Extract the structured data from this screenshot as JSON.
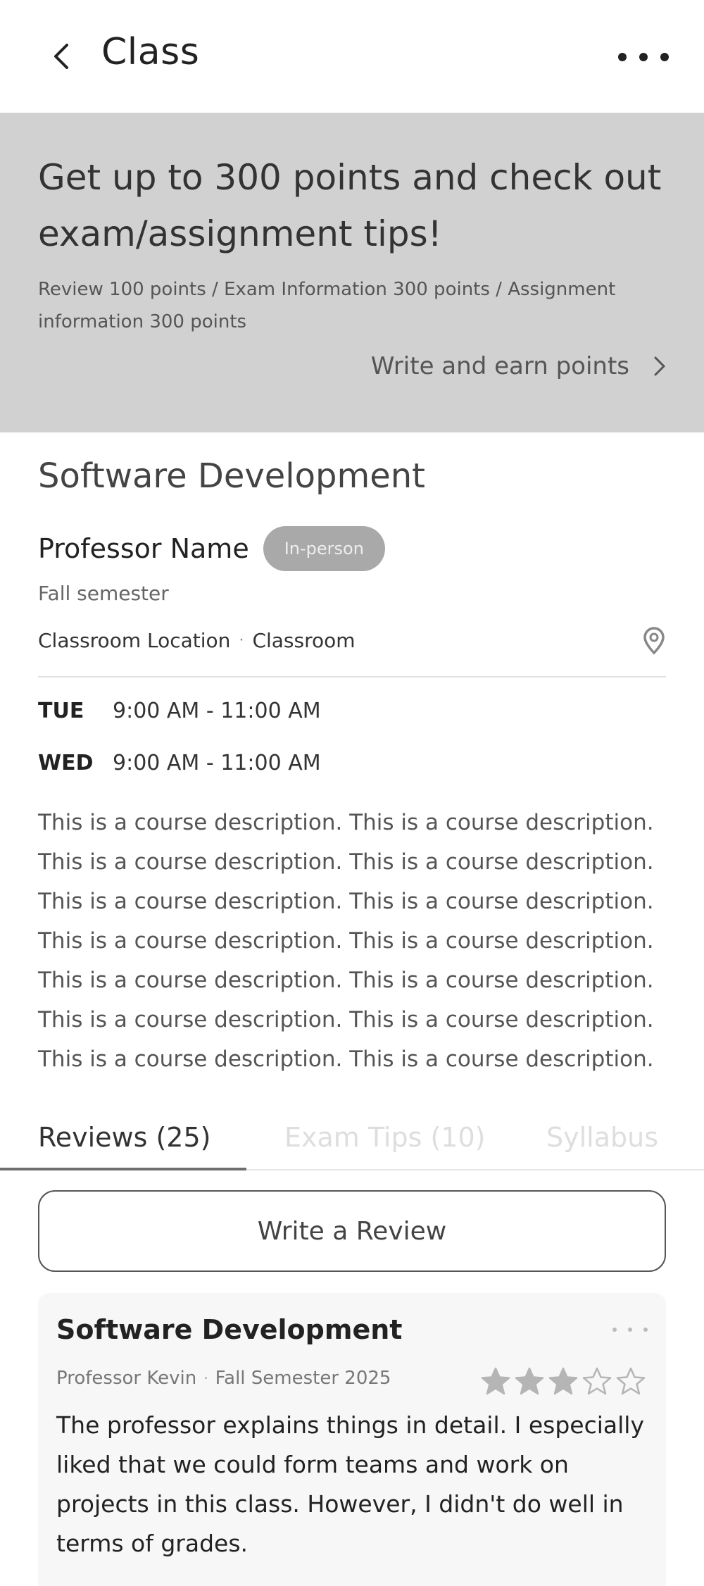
{
  "header": {
    "title": "Class",
    "back_icon": "chevron-left-icon",
    "more_icon": "more-horizontal-icon"
  },
  "promo": {
    "headline": "Get up to 300 points and check out exam/assignment tips!",
    "subtext": "Review 100 points / Exam Information 300 points / Assignment information 300 points",
    "cta_label": "Write and earn points",
    "cta_icon": "chevron-right-icon",
    "background_color": "#d1d1d1"
  },
  "course": {
    "title": "Software Development",
    "professor": "Professor Name",
    "mode_badge": "In-person",
    "semester": "Fall semester",
    "location": "Classroom Location",
    "location_separator": "·",
    "room": "Classroom",
    "location_icon": "map-pin-icon",
    "schedule": [
      {
        "day": "TUE",
        "time": "9:00 AM - 11:00 AM"
      },
      {
        "day": "WED",
        "time": "9:00 AM - 11:00 AM"
      }
    ],
    "description_lines": [
      "This is a course description. This is a course description.",
      "This is a course description. This is a course description.",
      "This is a course description. This is a course description.",
      "This is a course description. This is a course description.",
      "This is a course description. This is a course description.",
      "This is a course description. This is a course description.",
      "This is a course description. This is a course description."
    ]
  },
  "tabs": [
    {
      "label": "Reviews (25)",
      "active": true
    },
    {
      "label": "Exam Tips (10)",
      "active": false
    },
    {
      "label": "Syllabus",
      "active": false
    }
  ],
  "write_review_label": "Write a Review",
  "reviews": [
    {
      "course": "Software Development",
      "professor": "Professor Kevin",
      "meta_separator": "·",
      "semester": "Fall Semester 2025",
      "rating": 3,
      "rating_max": 5,
      "body": "The professor explains things in detail. I especially liked that we could form teams and work on projects in this class. However, I didn't do well in terms of grades."
    }
  ]
}
